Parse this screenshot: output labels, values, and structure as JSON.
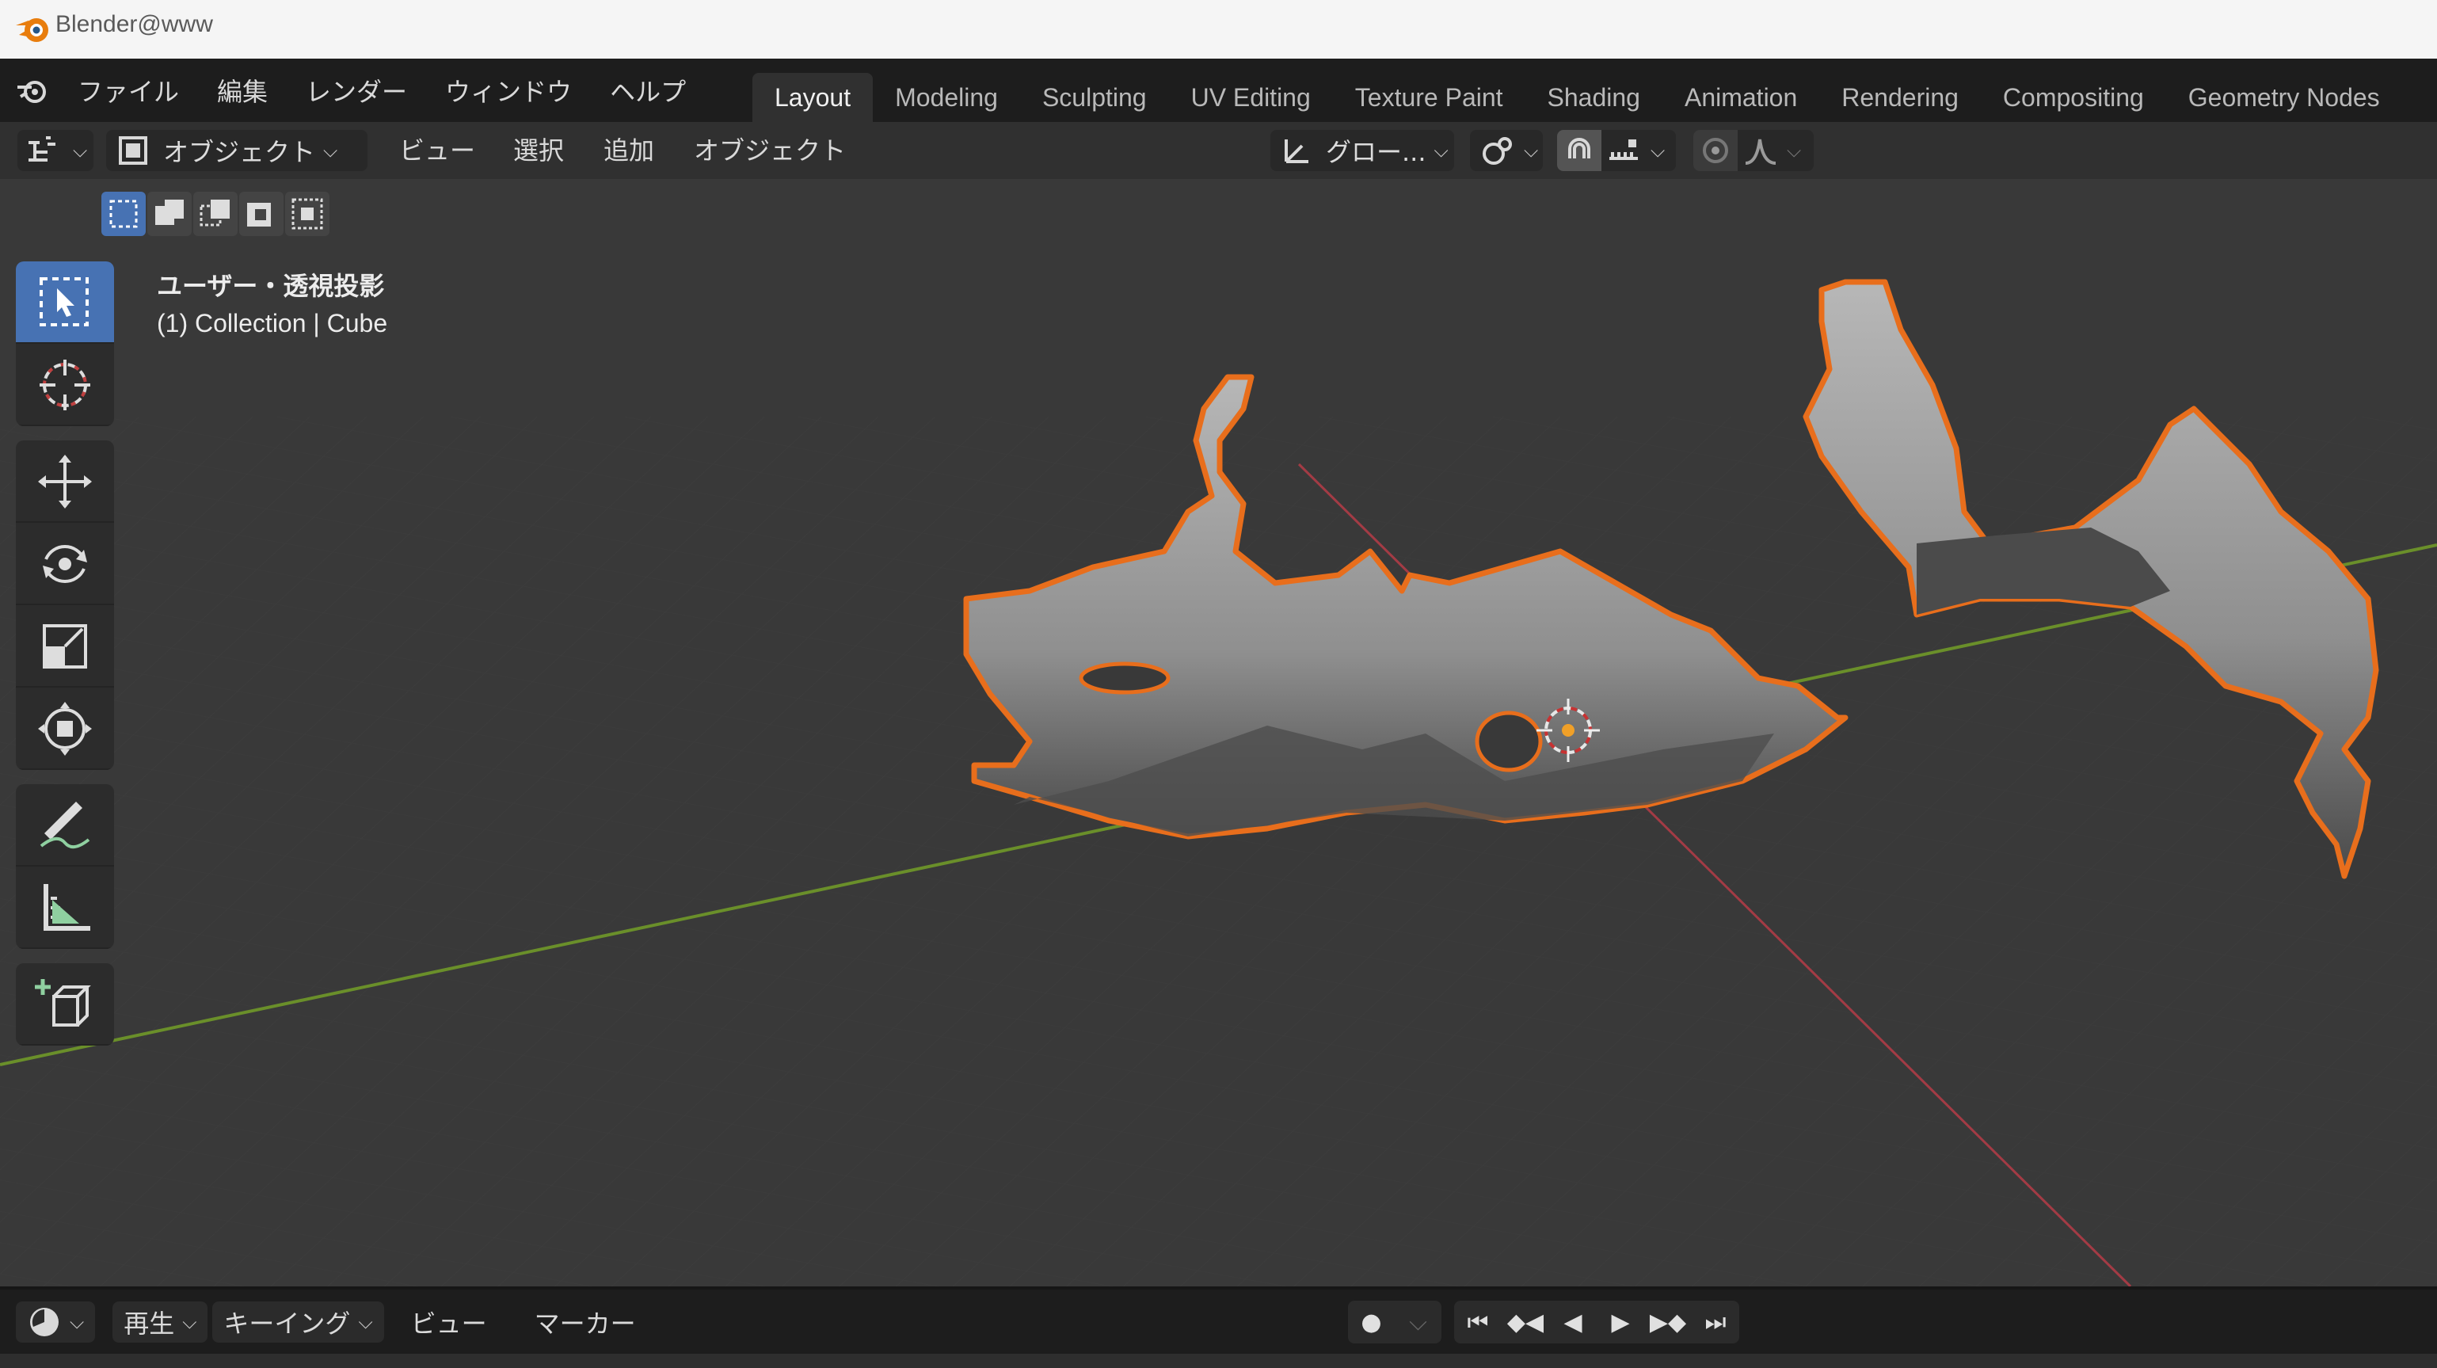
{
  "window": {
    "title": "Blender@www"
  },
  "menubar": {
    "menus": [
      "ファイル",
      "編集",
      "レンダー",
      "ウィンドウ",
      "ヘルプ"
    ],
    "tabs": [
      {
        "label": "Layout",
        "active": true
      },
      {
        "label": "Modeling"
      },
      {
        "label": "Sculpting"
      },
      {
        "label": "UV Editing"
      },
      {
        "label": "Texture Paint"
      },
      {
        "label": "Shading"
      },
      {
        "label": "Animation"
      },
      {
        "label": "Rendering"
      },
      {
        "label": "Compositing"
      },
      {
        "label": "Geometry Nodes"
      }
    ]
  },
  "header": {
    "mode": "オブジェクト",
    "menus": [
      "ビュー",
      "選択",
      "追加",
      "オブジェクト"
    ],
    "orientation": "グロー..."
  },
  "viewport": {
    "view_label": "ユーザー・透視投影",
    "collection_label": "(1) Collection | Cube"
  },
  "timeline": {
    "playback_label": "再生",
    "keying_label": "キーイング",
    "view_label": "ビュー",
    "marker_label": "マーカー"
  },
  "colors": {
    "accent": "#4772b3",
    "outline": "#e86e1c",
    "x_axis": "#a33b45",
    "y_axis": "#6a8f2a"
  },
  "icons": [
    "blender-logo-icon",
    "select-box-icon",
    "cursor-icon",
    "move-icon",
    "rotate-icon",
    "scale-icon",
    "transform-icon",
    "annotate-icon",
    "measure-icon",
    "add-cube-icon"
  ]
}
